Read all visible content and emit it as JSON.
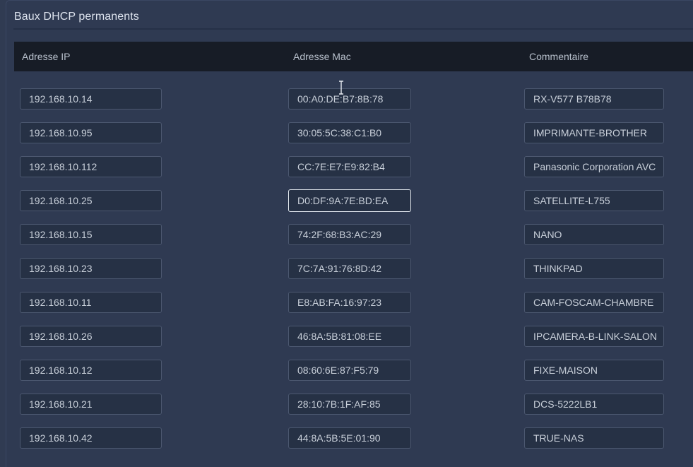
{
  "panel": {
    "title": "Baux DHCP permanents"
  },
  "table": {
    "headers": {
      "ip": "Adresse IP",
      "mac": "Adresse Mac",
      "comment": "Commentaire"
    },
    "rows": [
      {
        "ip": "192.168.10.14",
        "mac": "00:A0:DE:B7:8B:78",
        "comment": "RX-V577 B78B78"
      },
      {
        "ip": "192.168.10.95",
        "mac": "30:05:5C:38:C1:B0",
        "comment": "IMPRIMANTE-BROTHER"
      },
      {
        "ip": "192.168.10.112",
        "mac": "CC:7E:E7:E9:82:B4",
        "comment": "Panasonic Corporation AVC"
      },
      {
        "ip": "192.168.10.25",
        "mac": "D0:DF:9A:7E:BD:EA",
        "comment": "SATELLITE-L755"
      },
      {
        "ip": "192.168.10.15",
        "mac": "74:2F:68:B3:AC:29",
        "comment": "NANO"
      },
      {
        "ip": "192.168.10.23",
        "mac": "7C:7A:91:76:8D:42",
        "comment": "THINKPAD"
      },
      {
        "ip": "192.168.10.11",
        "mac": "E8:AB:FA:16:97:23",
        "comment": "CAM-FOSCAM-CHAMBRE"
      },
      {
        "ip": "192.168.10.26",
        "mac": "46:8A:5B:81:08:EE",
        "comment": "IPCAMERA-B-LINK-SALON"
      },
      {
        "ip": "192.168.10.12",
        "mac": "08:60:6E:87:F5:79",
        "comment": "FIXE-MAISON"
      },
      {
        "ip": "192.168.10.21",
        "mac": "28:10:7B:1F:AF:85",
        "comment": "DCS-5222LB1"
      },
      {
        "ip": "192.168.10.42",
        "mac": "44:8A:5B:5E:01:90",
        "comment": "TRUE-NAS"
      }
    ]
  },
  "colors": {
    "background": "#2f3a52",
    "header_bg": "#171c26",
    "field_bg": "#263145",
    "field_border": "#4c5870",
    "focus_border": "#e6ebf2"
  },
  "icons": {
    "cursor": "text-cursor-icon"
  }
}
